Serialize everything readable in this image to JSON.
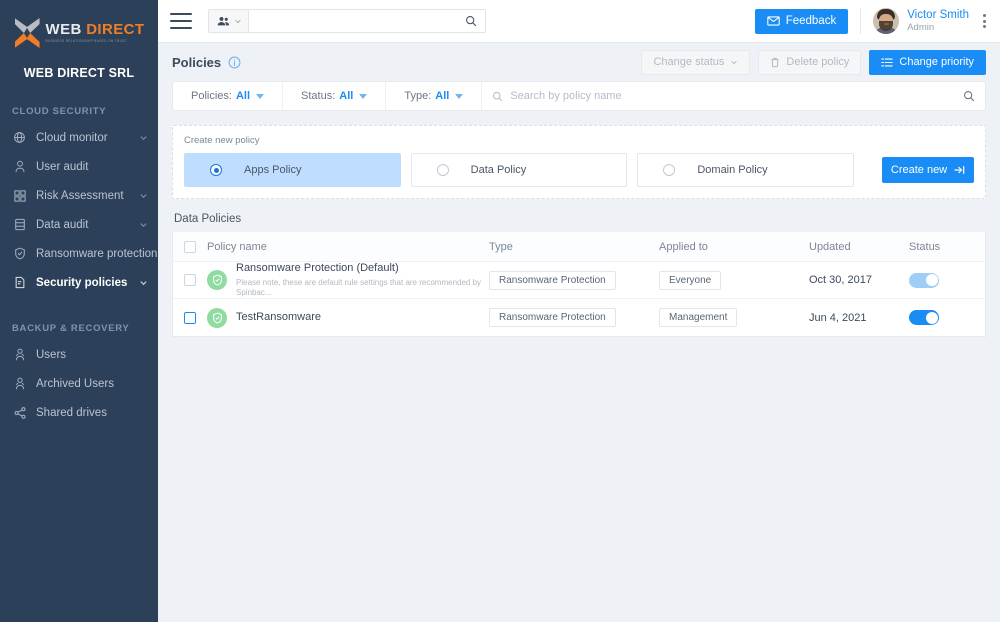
{
  "sidebar": {
    "logo": {
      "word1": "WEB",
      "word2": "DIRECT",
      "tagline": "BUSINESS RELATIONSHIP BASED ON TRUST"
    },
    "org_name": "WEB DIRECT SRL",
    "sections": [
      {
        "title": "CLOUD SECURITY",
        "items": [
          {
            "label": "Cloud monitor",
            "icon": "globe-icon",
            "chevron": true,
            "active": false
          },
          {
            "label": "User audit",
            "icon": "user-icon",
            "chevron": false,
            "active": false
          },
          {
            "label": "Risk Assessment",
            "icon": "grid-icon",
            "chevron": true,
            "active": false
          },
          {
            "label": "Data audit",
            "icon": "database-icon",
            "chevron": true,
            "active": false
          },
          {
            "label": "Ransomware protection",
            "icon": "shield-check-icon",
            "chevron": false,
            "active": false
          },
          {
            "label": "Security policies",
            "icon": "policy-icon",
            "chevron": true,
            "active": true
          }
        ]
      },
      {
        "title": "BACKUP & RECOVERY",
        "items": [
          {
            "label": "Users",
            "icon": "users-icon",
            "chevron": false,
            "active": false
          },
          {
            "label": "Archived Users",
            "icon": "archived-user-icon",
            "chevron": false,
            "active": false
          },
          {
            "label": "Shared drives",
            "icon": "share-icon",
            "chevron": false,
            "active": false
          }
        ]
      }
    ]
  },
  "topbar": {
    "search_placeholder": "",
    "search_value": "",
    "feedback_label": "Feedback",
    "user_name": "Victor Smith",
    "user_role": "Admin"
  },
  "page": {
    "title": "Policies",
    "actions": {
      "change_status": "Change status",
      "delete_policy": "Delete policy",
      "change_priority": "Change priority"
    }
  },
  "filters": {
    "policies": {
      "label": "Policies:",
      "value": "All"
    },
    "status": {
      "label": "Status:",
      "value": "All"
    },
    "type": {
      "label": "Type:",
      "value": "All"
    },
    "search_placeholder": "Search by policy name",
    "search_value": ""
  },
  "create": {
    "label": "Create new policy",
    "options": [
      {
        "label": "Apps Policy",
        "selected": true
      },
      {
        "label": "Data Policy",
        "selected": false
      },
      {
        "label": "Domain Policy",
        "selected": false
      }
    ],
    "button": "Create new"
  },
  "table": {
    "title": "Data Policies",
    "columns": {
      "name": "Policy name",
      "type": "Type",
      "applied": "Applied to",
      "updated": "Updated",
      "status": "Status"
    },
    "rows": [
      {
        "name": "Ransomware Protection (Default)",
        "desc": "Please note, these are default rule settings that are recommended by Spinbac...",
        "type": "Ransomware Protection",
        "applied": "Everyone",
        "updated": "Oct 30, 2017",
        "enabled": true,
        "toggle_style": "soft",
        "checkbox_blue": false
      },
      {
        "name": "TestRansomware",
        "desc": "",
        "type": "Ransomware Protection",
        "applied": "Management",
        "updated": "Jun 4, 2021",
        "enabled": true,
        "toggle_style": "on",
        "checkbox_blue": true
      }
    ]
  },
  "colors": {
    "sidebar_bg": "#2d4059",
    "accent_blue": "#1a8cf5",
    "accent_orange": "#f07e26",
    "shield_green": "#8fdba0",
    "selected_card": "#bfdeff"
  }
}
